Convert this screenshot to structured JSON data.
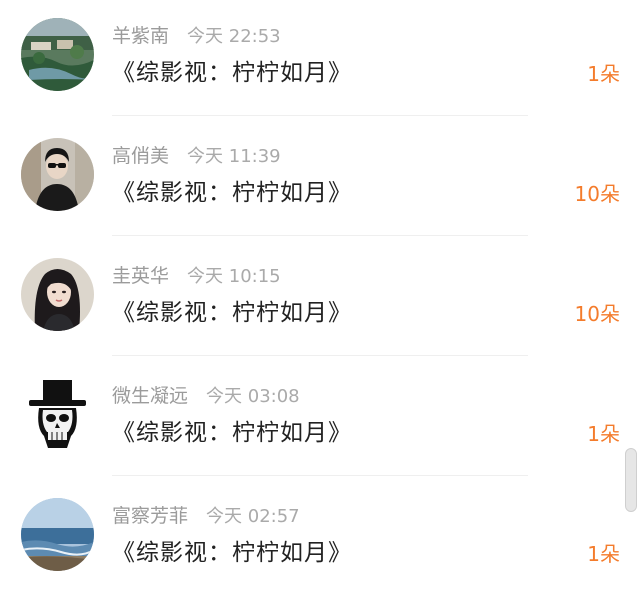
{
  "colors": {
    "accent": "#f47c2c",
    "name_text": "#9b9b9b",
    "title_text": "#222222"
  },
  "rows": [
    {
      "name": "羊紫南",
      "time": "今天 22:53",
      "title": "《综影视：柠柠如月》",
      "amount": "1朵",
      "avatar": "landscape-garden"
    },
    {
      "name": "高俏美",
      "time": "今天 11:39",
      "title": "《综影视：柠柠如月》",
      "amount": "10朵",
      "avatar": "person-sunglasses"
    },
    {
      "name": "圭英华",
      "time": "今天 10:15",
      "title": "《综影视：柠柠如月》",
      "amount": "10朵",
      "avatar": "woman-portrait"
    },
    {
      "name": "微生凝远",
      "time": "今天 03:08",
      "title": "《综影视：柠柠如月》",
      "amount": "1朵",
      "avatar": "skull-top-hat"
    },
    {
      "name": "富察芳菲",
      "time": "今天 02:57",
      "title": "《综影视：柠柠如月》",
      "amount": "1朵",
      "avatar": "seascape"
    }
  ]
}
